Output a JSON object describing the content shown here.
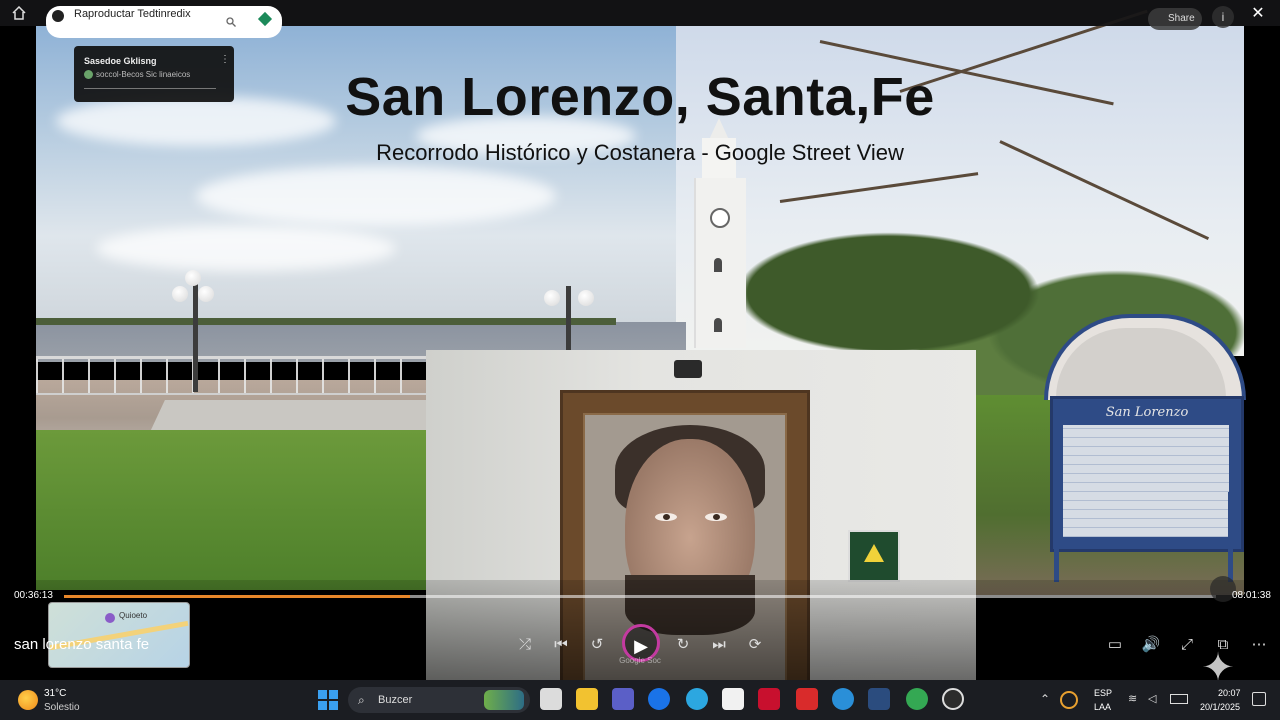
{
  "topbar": {
    "app_name": "Raproductar Tedtinredix",
    "share_label": "Share",
    "info_label": "i",
    "close_label": "✕"
  },
  "channel_card": {
    "title": "Sasedoe Gklisng",
    "subtitle": "soccol-Becos Sic linaeicos"
  },
  "video": {
    "title": "San Lorenzo, Santa,Fe",
    "subtitle": "Recorrodo Histórico y Costanera - Google Street View",
    "sign_text": "San Lorenzo",
    "watermark": "Google Soc"
  },
  "player": {
    "time_elapsed": "00:36:13",
    "time_total": "08:01:38",
    "progress": 0.3,
    "search_query": "san lorenzo santa fe",
    "map_thumb_label": "Quioeto",
    "controls": {
      "shuffle": "⤮",
      "prev": "⏮",
      "rewind": "↺",
      "play": "▶",
      "forward": "↻",
      "next": "⏭",
      "repeat": "⟳",
      "miniplayer": "▭",
      "volume": "🔊",
      "fullscreen": "⤢",
      "pip": "⧉",
      "more": "⋯"
    },
    "accent_color": "#e8872a"
  },
  "taskbar": {
    "weather_temp": "31°C",
    "weather_desc": "Solestio",
    "search_label": "Buzcer",
    "lang_top": "ESP",
    "lang_bottom": "LAA",
    "clock_time": "20:07",
    "clock_date": "20/1/2025",
    "app_icons": [
      "file-explorer-icon",
      "teams-icon",
      "hp-icon",
      "edge-dev-icon",
      "store-icon",
      "mcafee-icon",
      "ote-icon",
      "edge-icon",
      "terminal-icon",
      "chrome-icon",
      "media-player-icon"
    ]
  }
}
